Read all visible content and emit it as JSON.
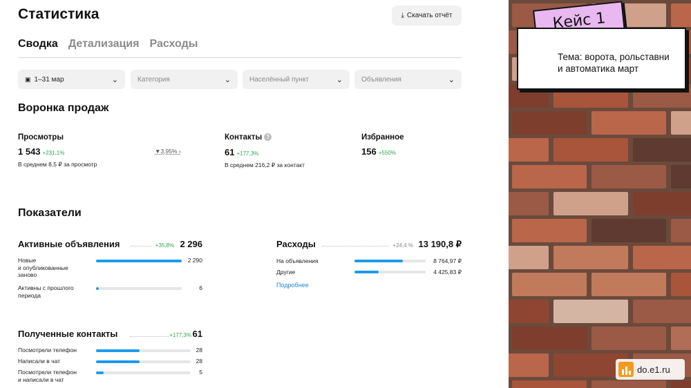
{
  "page": {
    "title": "Статистика",
    "download_label": "Скачать отчёт",
    "tabs": [
      {
        "label": "Сводка",
        "active": true
      },
      {
        "label": "Детализация",
        "active": false
      },
      {
        "label": "Расходы",
        "active": false
      }
    ],
    "filters": [
      {
        "label": "1–31 мар",
        "icon": "calendar-icon"
      },
      {
        "label": "Категория"
      },
      {
        "label": "Населённый пункт"
      },
      {
        "label": "Объявления"
      }
    ]
  },
  "funnel": {
    "heading": "Воронка продаж",
    "views": {
      "label": "Просмотры",
      "value": "1 543",
      "delta": "+231,1%",
      "sub": "В среднем 8,5 ₽ за просмотр",
      "conversion": "3,95%"
    },
    "contacts": {
      "label": "Контакты",
      "value": "61",
      "delta": "+177,3%",
      "sub": "В среднем 216,2 ₽ за контакт",
      "help": "?"
    },
    "favorites": {
      "label": "Избранное",
      "value": "156",
      "delta": "+550%"
    }
  },
  "indicators": {
    "heading": "Показатели",
    "active_ads": {
      "title": "Активные объявления",
      "delta": "+35,8%",
      "total": "2 296",
      "rows": [
        {
          "label_lines": [
            "Новые",
            "и опубликованные",
            "заново"
          ],
          "value": "2 290",
          "fill": 0.997
        },
        {
          "label_lines": [
            "Активны с прошлого",
            "периода"
          ],
          "value": "6",
          "fill": 0.03
        }
      ]
    },
    "expenses": {
      "title": "Расходы",
      "delta": "+24,4 %",
      "total": "13 190,8 ₽",
      "rows": [
        {
          "label": "На объявления",
          "value": "8 764,97 ₽",
          "fill": 0.68
        },
        {
          "label": "Другие",
          "value": "4 425,83 ₽",
          "fill": 0.34
        }
      ],
      "more": "Подробнее"
    },
    "contacts": {
      "title": "Полученные контакты",
      "delta": "+177,3%",
      "total": "61",
      "rows": [
        {
          "label_lines": [
            "Посмотрели телефон"
          ],
          "value": "28",
          "fill": 0.46
        },
        {
          "label_lines": [
            "Написали в чат"
          ],
          "value": "28",
          "fill": 0.46
        },
        {
          "label_lines": [
            "Посмотрели телефон",
            "и написали в чат"
          ],
          "value": "5",
          "fill": 0.08
        }
      ]
    }
  },
  "sidebar": {
    "case_label": "Кейс 1",
    "topic_lines": [
      "Тема: ворота, рольставни",
      "и автоматика март"
    ],
    "logo_text": "do.e1.ru"
  },
  "colors": {
    "accent": "#1e9be8",
    "positive": "#2fa84f",
    "tag": "#e9b8f0",
    "logo": "#f39a1e"
  }
}
